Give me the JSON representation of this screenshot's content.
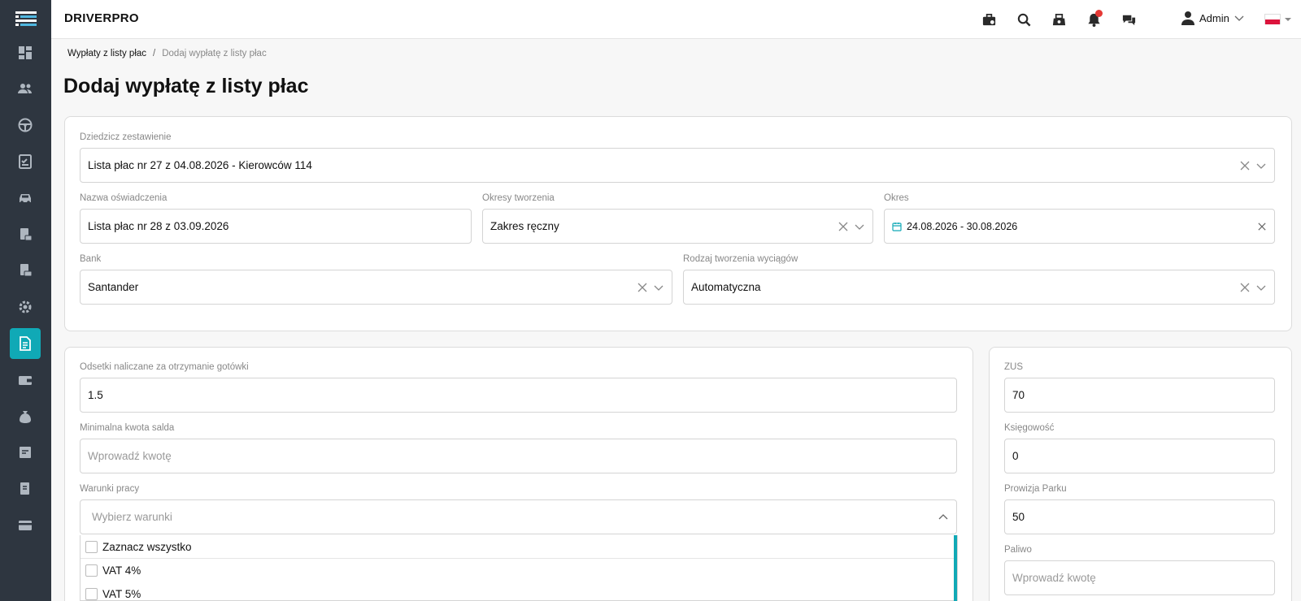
{
  "app": {
    "brand": "DRIVERPRO"
  },
  "header": {
    "user_name": "Admin"
  },
  "breadcrumb": {
    "parent": "Wypłaty z listy płac",
    "separator": "/",
    "current": "Dodaj wypłatę z listy płac"
  },
  "page": {
    "title": "Dodaj wypłatę z listy płac"
  },
  "form": {
    "inherit": {
      "label": "Dziedzicz zestawienie",
      "value": "Lista płac nr 27 z 04.08.2026 - Kierowców 114"
    },
    "statement_name": {
      "label": "Nazwa oświadczenia",
      "value": "Lista płac nr 28 z 03.09.2026"
    },
    "creation_periods": {
      "label": "Okresy tworzenia",
      "value": "Zakres ręczny"
    },
    "period": {
      "label": "Okres",
      "value": "24.08.2026 - 30.08.2026"
    },
    "bank": {
      "label": "Bank",
      "value": "Santander"
    },
    "statement_type": {
      "label": "Rodzaj tworzenia wyciągów",
      "value": "Automatyczna"
    },
    "cash_interest": {
      "label": "Odsetki naliczane za otrzymanie gotówki",
      "value": "1.5"
    },
    "min_balance": {
      "label": "Minimalna kwota salda",
      "placeholder": "Wprowadź kwotę"
    },
    "work_conditions": {
      "label": "Warunki pracy",
      "placeholder": "Wybierz warunki",
      "options": [
        "Zaznacz wszystko",
        "VAT 4%",
        "VAT 5%"
      ]
    },
    "zus": {
      "label": "ZUS",
      "value": "70"
    },
    "accounting": {
      "label": "Księgowość",
      "value": "0"
    },
    "park_commission": {
      "label": "Prowizja Parku",
      "value": "50"
    },
    "fuel": {
      "label": "Paliwo",
      "placeholder": "Wprowadź kwotę"
    }
  },
  "colors": {
    "sidebar": "#2e3640",
    "accent": "#10a9b6",
    "notification": "#e53935"
  }
}
